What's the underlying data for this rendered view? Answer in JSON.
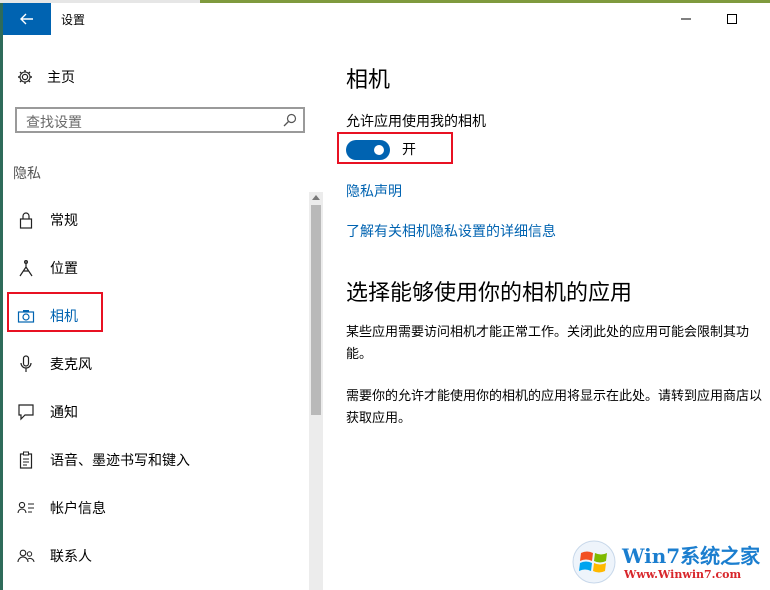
{
  "window": {
    "title": "设置"
  },
  "sidebar": {
    "home_label": "主页",
    "search_placeholder": "查找设置",
    "section_label": "隐私",
    "items": [
      {
        "label": "常规",
        "icon": "lock-icon",
        "active": false
      },
      {
        "label": "位置",
        "icon": "location-icon",
        "active": false
      },
      {
        "label": "相机",
        "icon": "camera-icon",
        "active": true
      },
      {
        "label": "麦克风",
        "icon": "microphone-icon",
        "active": false
      },
      {
        "label": "通知",
        "icon": "notification-icon",
        "active": false
      },
      {
        "label": "语音、墨迹书写和键入",
        "icon": "clipboard-icon",
        "active": false
      },
      {
        "label": "帐户信息",
        "icon": "account-info-icon",
        "active": false
      },
      {
        "label": "联系人",
        "icon": "contacts-icon",
        "active": false
      }
    ]
  },
  "main": {
    "title": "相机",
    "allow_label": "允许应用使用我的相机",
    "toggle": {
      "state": "on",
      "label": "开"
    },
    "privacy_link": "隐私声明",
    "learn_more_link": "了解有关相机隐私设置的详细信息",
    "section_heading": "选择能够使用你的相机的应用",
    "paragraph1": "某些应用需要访问相机才能正常工作。关闭此处的应用可能会限制其功能。",
    "paragraph2": "需要你的允许才能使用你的相机的应用将显示在此处。请转到应用商店以获取应用。"
  },
  "colors": {
    "accent": "#0063b1",
    "highlight_box": "#e81123"
  },
  "watermark": {
    "text": "Win7系统之家",
    "url": "Www.Winwin7.com"
  }
}
